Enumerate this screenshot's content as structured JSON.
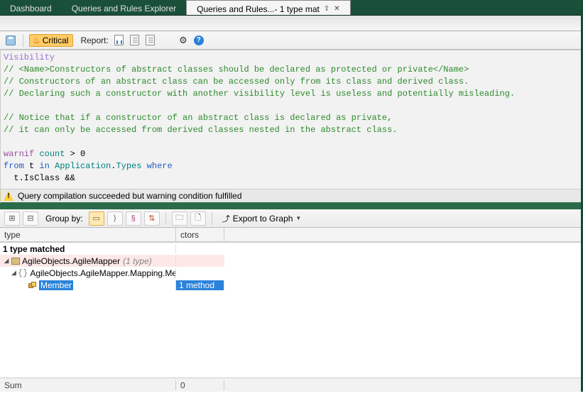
{
  "tabs": {
    "dashboard": "Dashboard",
    "explorer": "Queries and Rules Explorer",
    "active": "Queries and Rules...- 1 type mat"
  },
  "toolbar": {
    "critical": "Critical",
    "report": "Report:"
  },
  "code": {
    "visibility": "Visibility",
    "c1": "// <Name>Constructors of abstract classes should be declared as protected or private</Name>",
    "c2": "// Constructors of an abstract class can be accessed only from its class and derived class.",
    "c3": "// Declaring such a constructor with another visibility level is useless and potentially misleading.",
    "c4": "// Notice that if a constructor of an abstract class is declared as private,",
    "c5": "// it can only be accessed from derived classes nested in the abstract class.",
    "warnif": "warnif",
    "count": "count",
    "gt0": " > 0",
    "from": "from",
    "t": " t ",
    "in": "in",
    "app": " Application",
    "dot": ".",
    "types": "Types",
    "where": "where",
    "line3": "  t.IsClass &&"
  },
  "status": {
    "warn": "Query compilation succeeded but warning condition fulfilled"
  },
  "results_toolbar": {
    "group_by": "Group by:",
    "export": "Export to Graph"
  },
  "grid": {
    "col_type": "type",
    "col_ctors": "ctors",
    "matched": "1 type matched",
    "ns1": "AgileObjects.AgileMapper",
    "ns1_count": "(1 type)",
    "ns2": "AgileObjects.AgileMapper.Mapping.Memb",
    "member": "Member",
    "member_ctors": "1 method"
  },
  "footer": {
    "sum": "Sum",
    "val": "0"
  }
}
